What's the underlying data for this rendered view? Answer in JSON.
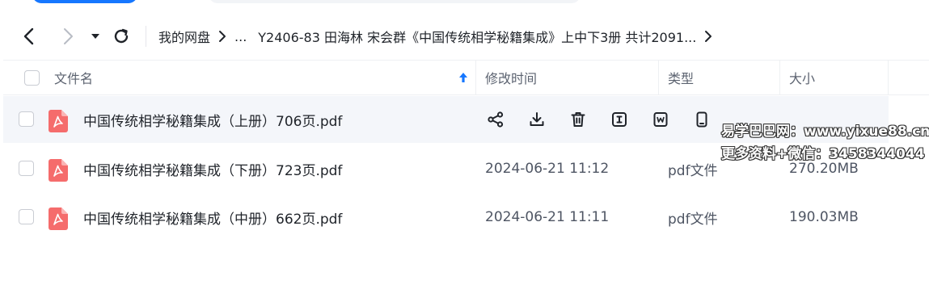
{
  "nav": {
    "back_icon": "chevron-left-icon",
    "forward_icon": "chevron-right-icon",
    "dropdown_icon": "caret-down-icon",
    "refresh_icon": "refresh-icon"
  },
  "breadcrumb": {
    "root": "我的网盘",
    "ellipsis": "...",
    "current": "Y2406-83 田海林 宋会群《中国传统相学秘籍集成》上中下3册 共计2091...",
    "separator_icon": "chevron-right-icon"
  },
  "table": {
    "headers": {
      "name": "文件名",
      "modified": "修改时间",
      "type": "类型",
      "size": "大小"
    },
    "sort_icon": "arrow-up-icon",
    "rows": [
      {
        "name": "中国传统相学秘籍集成（上册）706页.pdf",
        "modified": "",
        "type": "",
        "size": "",
        "hover": true
      },
      {
        "name": "中国传统相学秘籍集成（下册）723页.pdf",
        "modified": "2024-06-21 11:12",
        "type": "pdf文件",
        "size": "270.20MB",
        "hover": false
      },
      {
        "name": "中国传统相学秘籍集成（中册）662页.pdf",
        "modified": "2024-06-21 11:11",
        "type": "pdf文件",
        "size": "190.03MB",
        "hover": false
      }
    ],
    "row_actions": [
      "share-icon",
      "download-icon",
      "delete-icon",
      "rename-icon",
      "word-convert-icon",
      "mobile-icon"
    ]
  },
  "watermark": {
    "line1": "易学巴巴网：www.yixue88.cn",
    "line2": "更多资料+微信：3458344044"
  },
  "colors": {
    "accent": "#1677ff",
    "pdf_red": "#f56c6c",
    "hover_row": "#f4f6fa"
  }
}
